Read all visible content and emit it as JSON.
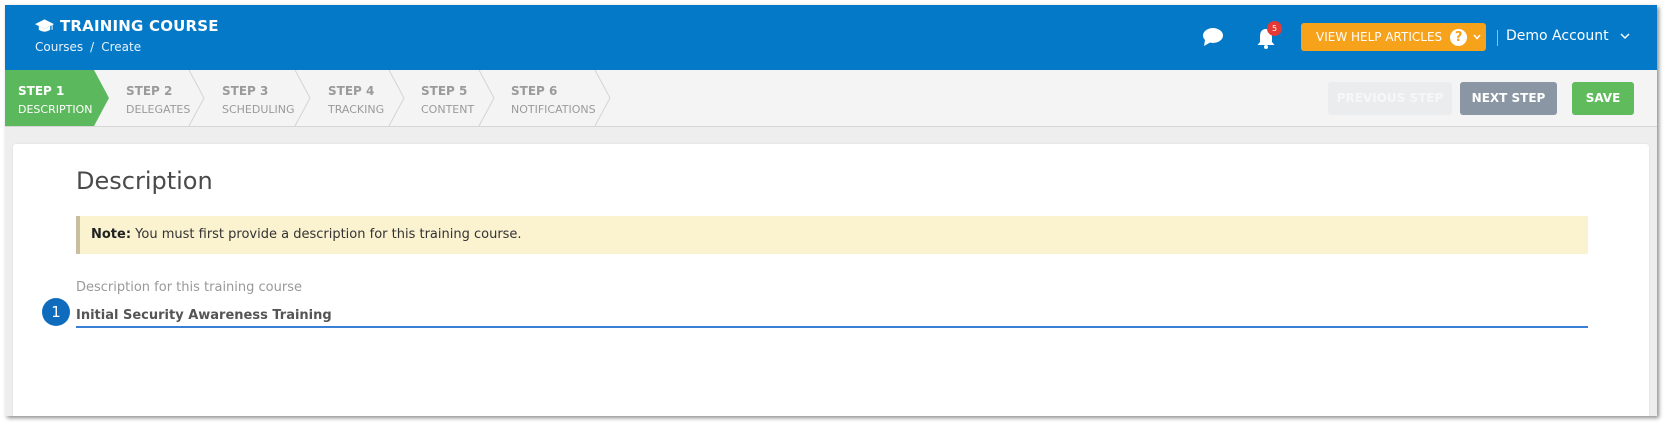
{
  "header": {
    "title": "TRAINING COURSE",
    "breadcrumb": [
      "Courses",
      "Create"
    ],
    "breadcrumb_sep": "/",
    "notifications_count": "5",
    "help_button": "VIEW HELP ARTICLES",
    "help_q": "?",
    "account": "Demo Account",
    "icons": [
      "graduation-cap-icon",
      "chat-icon",
      "bell-icon",
      "chevron-down-icon"
    ]
  },
  "steps": [
    {
      "num": "STEP 1",
      "label": "DESCRIPTION",
      "active": true
    },
    {
      "num": "STEP 2",
      "label": "DELEGATES",
      "active": false
    },
    {
      "num": "STEP 3",
      "label": "SCHEDULING",
      "active": false
    },
    {
      "num": "STEP 4",
      "label": "TRACKING",
      "active": false
    },
    {
      "num": "STEP 5",
      "label": "CONTENT",
      "active": false
    },
    {
      "num": "STEP 6",
      "label": "NOTIFICATIONS",
      "active": false
    }
  ],
  "actions": {
    "previous": "PREVIOUS STEP",
    "next": "NEXT STEP",
    "save": "SAVE"
  },
  "content": {
    "title": "Description",
    "note_label": "Note:",
    "note_text": " You must first provide a description for this training course.",
    "field_label": "Description for this training course",
    "field_value": "Initial Security Awareness Training",
    "marker": "1"
  },
  "colors": {
    "header": "#0479c8",
    "active_step": "#5cb85c",
    "help_button": "#f7a21b",
    "next_button": "#8a96a3",
    "save_button": "#5fbb5c",
    "note_bg": "#fbf2d0",
    "input_underline": "#3a7fd6",
    "badge": "#e53935"
  }
}
